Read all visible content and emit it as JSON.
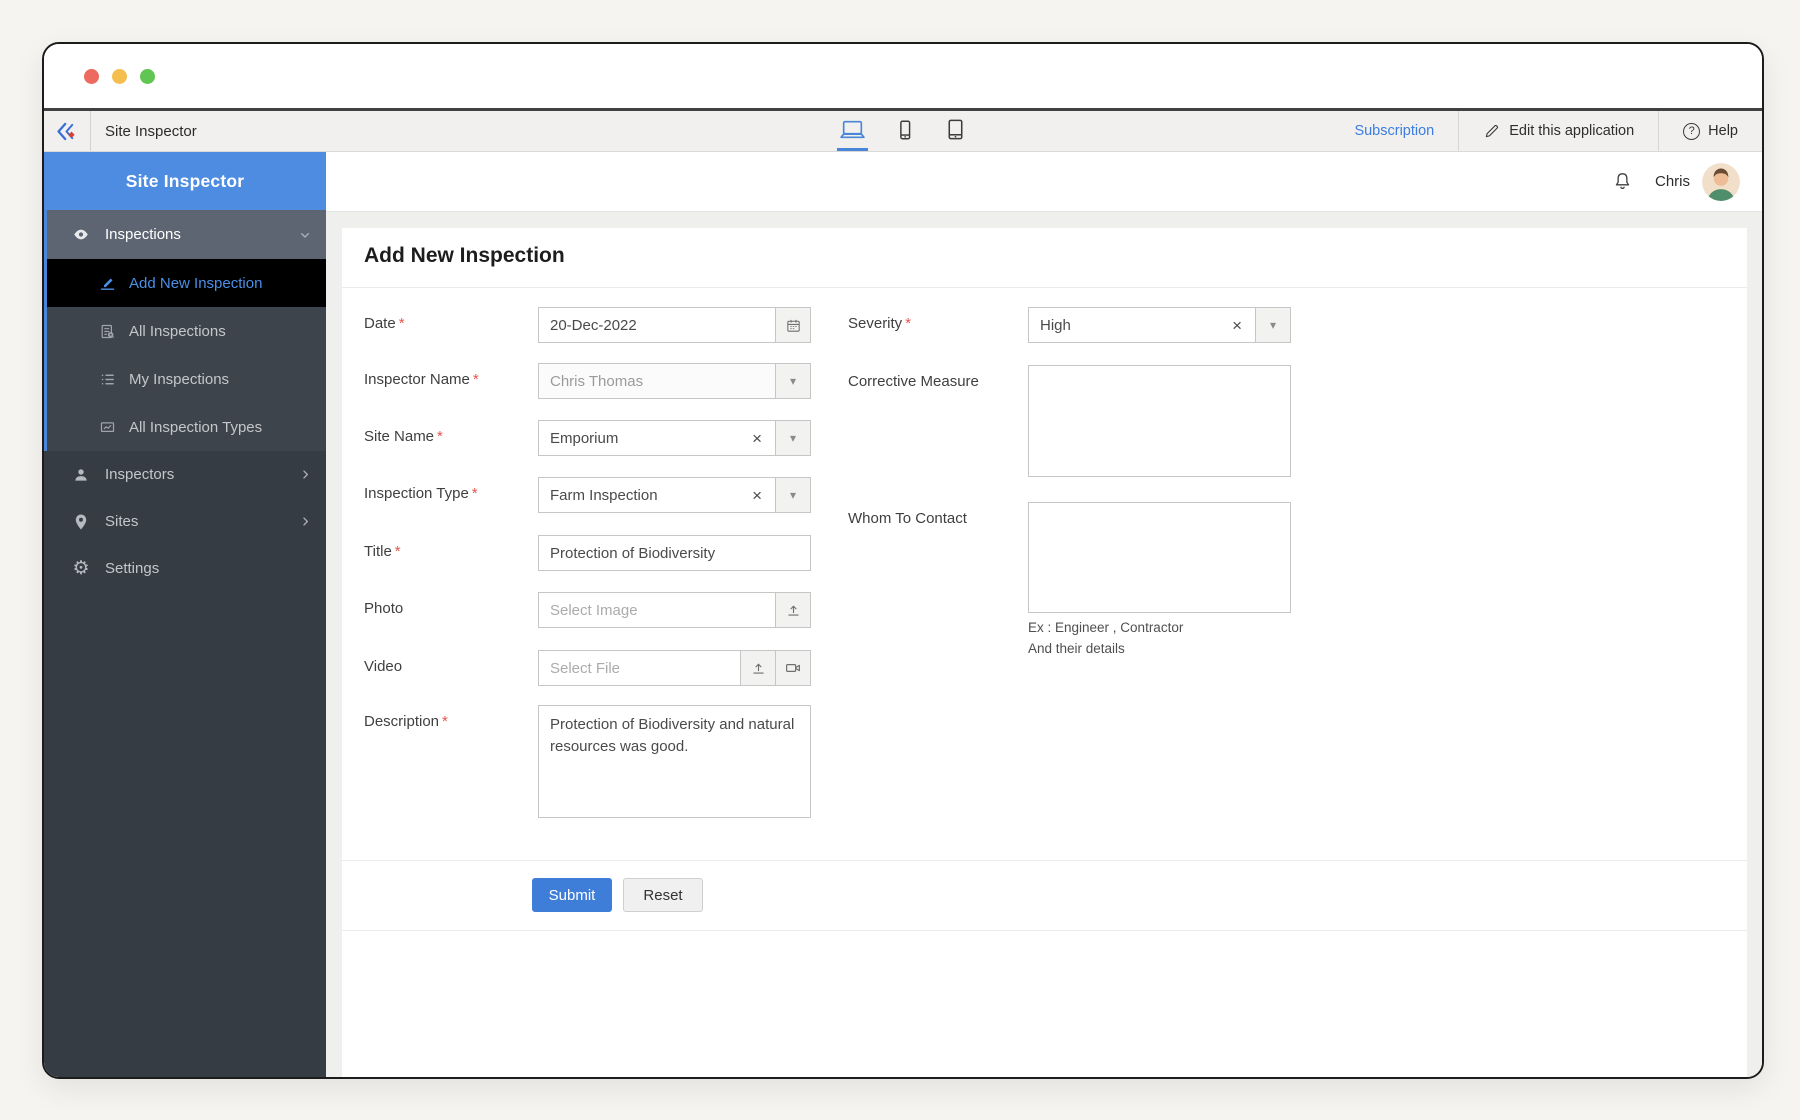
{
  "colors": {
    "accent_blue": "#4a86d8",
    "sidebar_header_blue": "#4d8ce0",
    "active_item_text": "#4a8fe8",
    "link_blue": "#3b7de0",
    "submit_blue": "#3f7ed8",
    "required_red": "#e2574c",
    "traffic_red": "#ed6a5e",
    "traffic_yellow": "#f4bf4f",
    "traffic_green": "#61c554"
  },
  "toolbar": {
    "app_name": "Site Inspector",
    "subscription_label": "Subscription",
    "edit_label": "Edit this application",
    "help_label": "Help",
    "devices": [
      {
        "name": "desktop",
        "active": true
      },
      {
        "name": "mobile",
        "active": false
      },
      {
        "name": "tablet",
        "active": false
      }
    ]
  },
  "sidebar": {
    "app_title": "Site Inspector",
    "items": [
      {
        "label": "Inspections",
        "icon": "eye-icon",
        "expanded": true,
        "children": [
          {
            "label": "Add New Inspection",
            "icon": "form-edit-icon",
            "active": true
          },
          {
            "label": "All Inspections",
            "icon": "document-icon"
          },
          {
            "label": "My Inspections",
            "icon": "list-icon"
          },
          {
            "label": "All Inspection Types",
            "icon": "chart-icon"
          }
        ]
      },
      {
        "label": "Inspectors",
        "icon": "person-icon",
        "has_children": true
      },
      {
        "label": "Sites",
        "icon": "pin-icon",
        "has_children": true
      },
      {
        "label": "Settings",
        "icon": "gear-icon"
      }
    ]
  },
  "header": {
    "user_name": "Chris"
  },
  "page": {
    "title": "Add New Inspection"
  },
  "form": {
    "required_marker": "*",
    "fields": {
      "date": {
        "label": "Date",
        "value": "20-Dec-2022"
      },
      "inspector": {
        "label": "Inspector Name",
        "value": "Chris Thomas"
      },
      "site": {
        "label": "Site Name",
        "value": "Emporium"
      },
      "type": {
        "label": "Inspection Type",
        "value": "Farm Inspection"
      },
      "title": {
        "label": "Title",
        "value": "Protection of Biodiversity"
      },
      "photo": {
        "label": "Photo",
        "placeholder": "Select Image"
      },
      "video": {
        "label": "Video",
        "placeholder": "Select File"
      },
      "description": {
        "label": "Description",
        "value": "Protection of Biodiversity and natural resources was good."
      },
      "severity": {
        "label": "Severity",
        "value": "High"
      },
      "corrective": {
        "label": "Corrective Measure",
        "value": ""
      },
      "whom": {
        "label": "Whom To Contact",
        "value": "",
        "helper1": "Ex : Engineer , Contractor",
        "helper2": "And their details"
      }
    },
    "submit_label": "Submit",
    "reset_label": "Reset"
  },
  "icons": {
    "gear": "⚙",
    "caret": "▾",
    "close": "×",
    "help": "?"
  }
}
